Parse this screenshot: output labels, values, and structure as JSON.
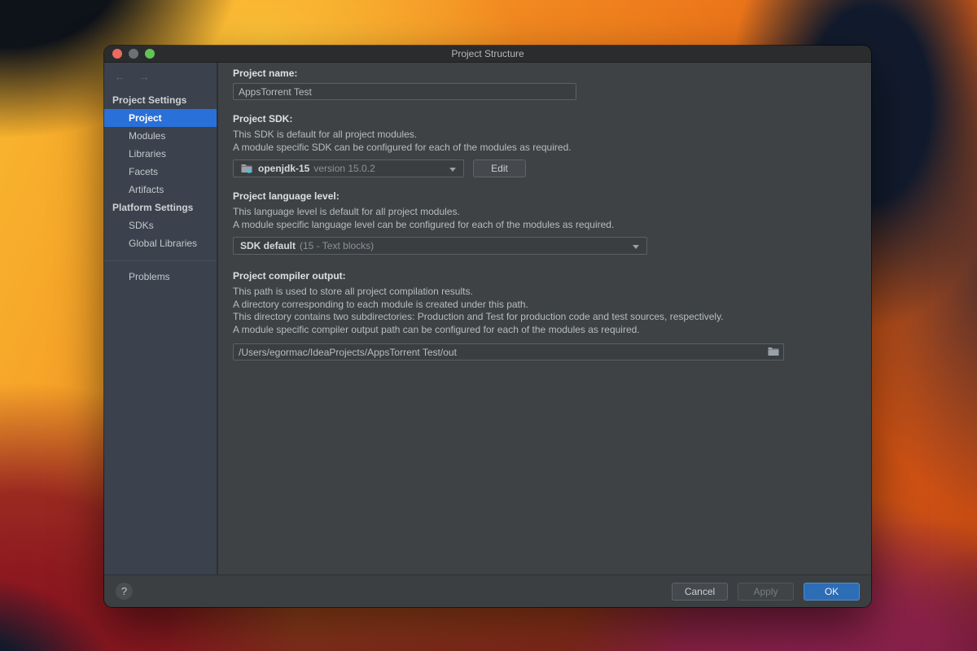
{
  "window": {
    "title": "Project Structure"
  },
  "titlebar_icons": {
    "close_color": "#ed6a5e",
    "minimize_color": "#6d7075",
    "zoom_color": "#61c554"
  },
  "nav": {
    "back": "←",
    "forward": "→"
  },
  "sidebar": {
    "selected": "Project",
    "sections": [
      {
        "header": "Project Settings",
        "items": [
          "Project",
          "Modules",
          "Libraries",
          "Facets",
          "Artifacts"
        ]
      },
      {
        "header": "Platform Settings",
        "items": [
          "SDKs",
          "Global Libraries"
        ]
      }
    ],
    "problems": "Problems"
  },
  "main": {
    "project_name": {
      "label": "Project name:",
      "value": "AppsTorrent Test"
    },
    "project_sdk": {
      "label": "Project SDK:",
      "desc1": "This SDK is default for all project modules.",
      "desc2": "A module specific SDK can be configured for each of the modules as required.",
      "combo_name": "openjdk-15",
      "combo_version": "version 15.0.2",
      "edit_button": "Edit"
    },
    "language_level": {
      "label": "Project language level:",
      "desc1": "This language level is default for all project modules.",
      "desc2": "A module specific language level can be configured for each of the modules as required.",
      "combo_main": "SDK default",
      "combo_detail": "(15 - Text blocks)"
    },
    "compiler_output": {
      "label": "Project compiler output:",
      "desc1": "This path is used to store all project compilation results.",
      "desc2": "A directory corresponding to each module is created under this path.",
      "desc3": "This directory contains two subdirectories: Production and Test for production code and test sources, respectively.",
      "desc4": "A module specific compiler output path can be configured for each of the modules as required.",
      "path": "/Users/egormac/IdeaProjects/AppsTorrent Test/out"
    }
  },
  "footer": {
    "help": "?",
    "cancel": "Cancel",
    "apply": "Apply",
    "ok": "OK"
  },
  "colors": {
    "selection_blue": "#2970d9",
    "ok_button_blue": "#2d6db6",
    "sidebar_bg": "#3b424d",
    "panel_bg": "#3e4245",
    "titlebar_bg": "#2b2c2e",
    "java_cup_cyan": "#41c4e4"
  }
}
